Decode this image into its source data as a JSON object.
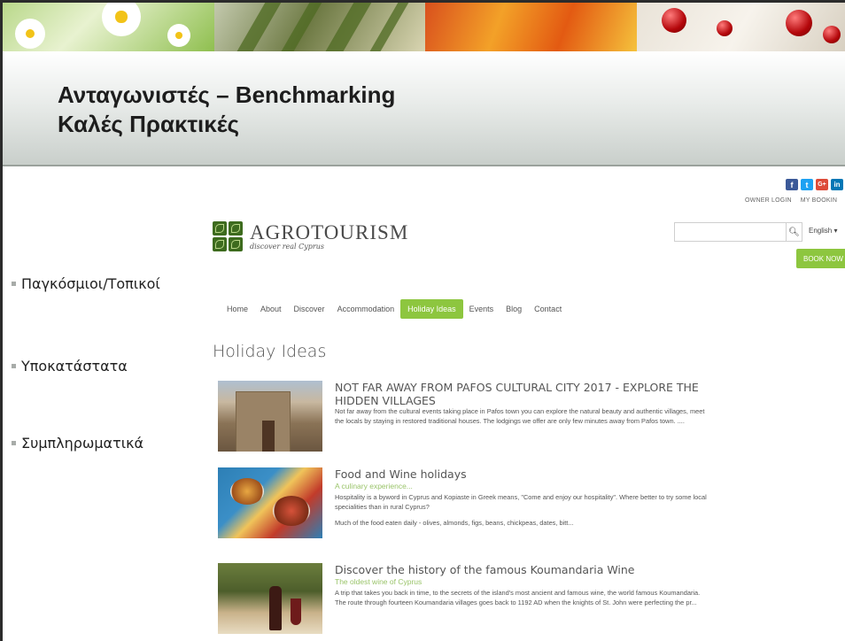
{
  "slide": {
    "title_line1": "Ανταγωνιστές – Benchmarking",
    "title_line2": "Καλές Πρακτικές",
    "bullets": [
      "Παγκόσμιοι/Τοπικοί",
      "Υποκατάστατα",
      "Συμπληρωματικά"
    ]
  },
  "site": {
    "social_icons": [
      "f",
      "t",
      "G+",
      "in"
    ],
    "top_links": [
      "OWNER LOGIN",
      "MY BOOKIN"
    ],
    "logo_name": "AGROTOURISM",
    "logo_tagline": "discover real Cyprus",
    "search": {
      "value": "",
      "placeholder": ""
    },
    "language": "English ▾",
    "book_now": "BOOK NOW",
    "nav": [
      "Home",
      "About",
      "Discover",
      "Accommodation",
      "Holiday Ideas",
      "Events",
      "Blog",
      "Contact"
    ],
    "active_nav": "Holiday Ideas",
    "page_heading": "Holiday Ideas",
    "articles": [
      {
        "title": "NOT FAR AWAY FROM PAFOS CULTURAL CITY 2017 - EXPLORE THE HIDDEN VILLAGES",
        "subtitle": "",
        "paragraphs": [
          "Not far away from the cultural events taking place in Pafos town you can explore the natural beauty and authentic villages, meet the locals by staying in restored traditional houses. The lodgings we offer are only few minutes away from Pafos town. ...."
        ]
      },
      {
        "title": "Food and Wine holidays",
        "subtitle": "A culinary experience...",
        "paragraphs": [
          "Hospitality is a byword in Cyprus and Kopiaste in Greek means, \"Come and enjoy our hospitality\". Where better to try some local specialities than in rural Cyprus?",
          "Much of the food eaten daily - olives, almonds, figs, beans, chickpeas, dates, bitt..."
        ]
      },
      {
        "title": "Discover the history of the famous Koumandaria Wine",
        "subtitle": "The oldest wine of Cyprus",
        "paragraphs": [
          "A trip that takes you back in time, to the secrets of the island's most ancient and famous wine, the world famous Koumandaria.",
          "The route through fourteen Koumandaria villages goes back to 1192 AD when the knights of St. John were perfecting the pr..."
        ]
      }
    ]
  },
  "colors": {
    "accent_green": "#8dc63f",
    "subtitle_green": "#9ac46a",
    "facebook": "#3b5998",
    "twitter": "#1da1f2",
    "googleplus": "#dd4b39",
    "linkedin": "#0077b5"
  }
}
